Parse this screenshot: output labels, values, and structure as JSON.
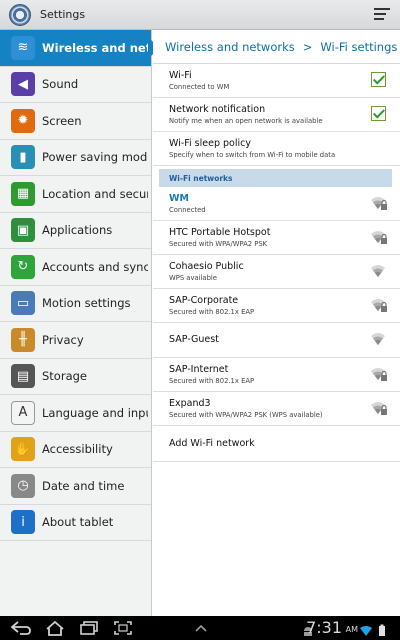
{
  "app": {
    "title": "Settings"
  },
  "sidebar": {
    "items": [
      {
        "label": "Wireless and netw",
        "icon": "wifi-icon",
        "color": "#2f8fd4",
        "active": true
      },
      {
        "label": "Sound",
        "icon": "speaker-icon",
        "color": "#5a3fa8"
      },
      {
        "label": "Screen",
        "icon": "brightness-icon",
        "color": "#e06a10"
      },
      {
        "label": "Power saving mode",
        "icon": "battery-icon",
        "color": "#2a8fb6"
      },
      {
        "label": "Location and securit",
        "icon": "location-grid-icon",
        "color": "#2f9a2f"
      },
      {
        "label": "Applications",
        "icon": "apps-icon",
        "color": "#2f8f3f"
      },
      {
        "label": "Accounts and sync",
        "icon": "sync-icon",
        "color": "#2ea43a"
      },
      {
        "label": "Motion settings",
        "icon": "tablet-motion-icon",
        "color": "#4a7bb8"
      },
      {
        "label": "Privacy",
        "icon": "fence-icon",
        "color": "#c98a2a"
      },
      {
        "label": "Storage",
        "icon": "storage-icon",
        "color": "#555555"
      },
      {
        "label": "Language and input",
        "icon": "letter-a-icon",
        "color": "#777777"
      },
      {
        "label": "Accessibility",
        "icon": "hand-icon",
        "color": "#e0a21a"
      },
      {
        "label": "Date and time",
        "icon": "clock-icon",
        "color": "#888888"
      },
      {
        "label": "About tablet",
        "icon": "info-icon",
        "color": "#1d6fc7"
      }
    ]
  },
  "breadcrumb": {
    "parent": "Wireless and networks",
    "separator": ">",
    "current": "Wi-Fi settings"
  },
  "settings": [
    {
      "title": "Wi-Fi",
      "subtitle": "Connected to WM",
      "checked": true
    },
    {
      "title": "Network notification",
      "subtitle": "Notify me when an open network is available",
      "checked": true
    },
    {
      "title": "Wi-Fi sleep policy",
      "subtitle": "Specify when to switch from Wi-Fi to mobile data"
    }
  ],
  "section_label": "Wi-Fi networks",
  "networks": [
    {
      "name": "WM",
      "status": "Connected",
      "secured": true,
      "connected": true
    },
    {
      "name": "HTC Portable Hotspot",
      "status": "Secured with WPA/WPA2 PSK",
      "secured": true
    },
    {
      "name": "Cohaesio Public",
      "status": "WPS available",
      "secured": false
    },
    {
      "name": "SAP-Corporate",
      "status": "Secured with 802.1x EAP",
      "secured": true
    },
    {
      "name": "SAP-Guest",
      "status": "",
      "secured": false
    },
    {
      "name": "SAP-Internet",
      "status": "Secured with 802.1x EAP",
      "secured": true
    },
    {
      "name": "Expand3",
      "status": "Secured with WPA/WPA2 PSK (WPS available)",
      "secured": true
    }
  ],
  "add_network": "Add Wi-Fi network",
  "status_bar": {
    "time": "7:31",
    "ampm": "AM"
  },
  "colors": {
    "accent": "#1583c3",
    "header_blue": "#0f6fa8",
    "section_bg": "#c8d9ea"
  }
}
